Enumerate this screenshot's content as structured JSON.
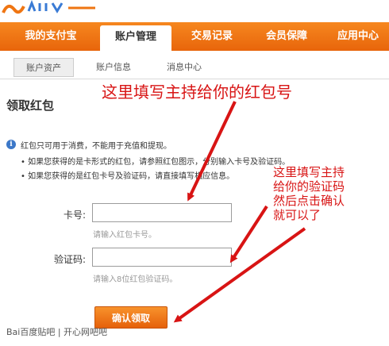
{
  "nav": {
    "tabs": [
      {
        "label": "我的支付宝"
      },
      {
        "label": "账户管理"
      },
      {
        "label": "交易记录"
      },
      {
        "label": "会员保障"
      },
      {
        "label": "应用中心"
      }
    ],
    "active_index": 1
  },
  "subnav": {
    "tabs": [
      {
        "label": "账户资产"
      },
      {
        "label": "账户信息"
      },
      {
        "label": "消息中心"
      }
    ],
    "active_index": 0
  },
  "page": {
    "title": "领取红包"
  },
  "notice": {
    "main": "红包只可用于消费，不能用于充值和提现。",
    "bullet1": "• 如果您获得的是卡形式的红包，请参照红包图示，分别输入卡号及验证码。",
    "bullet2": "• 如果您获得的是红包卡号及验证码，请直接填写相应信息。"
  },
  "form": {
    "card_label": "卡号:",
    "card_value": "",
    "card_hint": "请输入红包卡号。",
    "code_label": "验证码:",
    "code_value": "",
    "code_hint": "请输入8位红包验证码。",
    "submit_label": "确认领取"
  },
  "annotations": {
    "top": "这里填写主持给你的红包号",
    "right_lines": [
      "这里填写主持",
      "给你的验证码",
      "然后点击确认",
      "就可以了"
    ]
  },
  "watermark": "Bai百度贴吧 | 开心网吧吧",
  "colors": {
    "brand_orange": "#ef7512",
    "annotation_red": "#d81414",
    "info_blue": "#3c78c8"
  }
}
